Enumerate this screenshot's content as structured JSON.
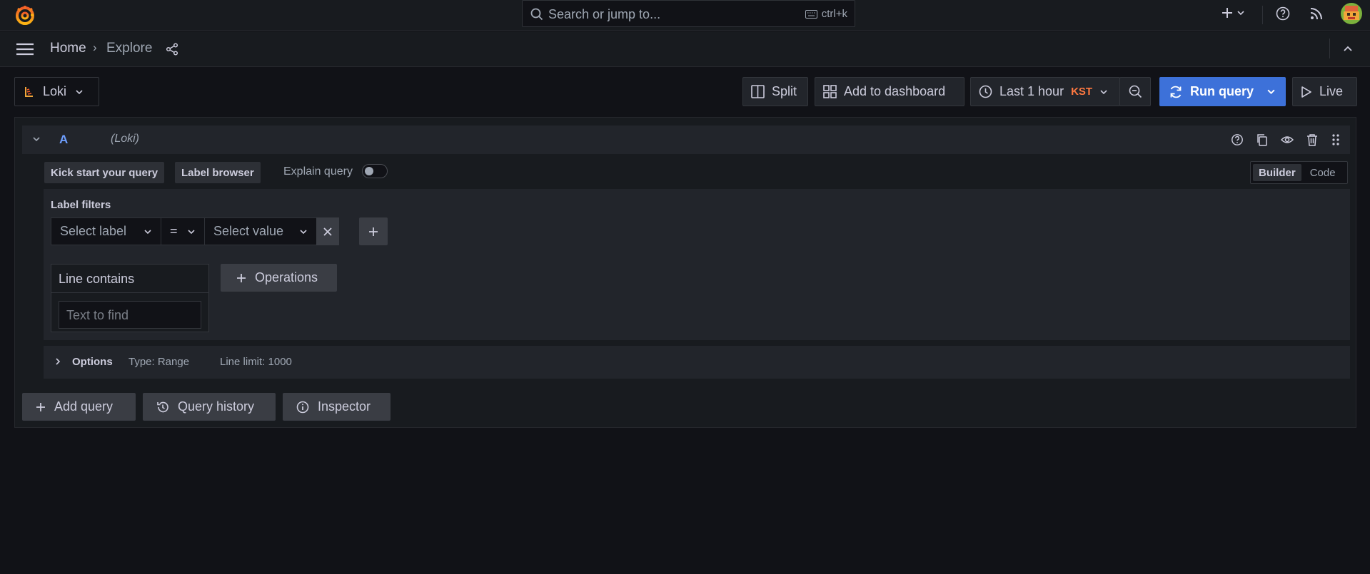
{
  "topbar": {
    "search_placeholder": "Search or jump to...",
    "search_shortcut": "ctrl+k"
  },
  "breadcrumb": {
    "home": "Home",
    "separator": "›",
    "current": "Explore"
  },
  "toolbar": {
    "datasource": "Loki",
    "split_label": "Split",
    "add_to_dashboard_label": "Add to dashboard",
    "time_range_label": "Last 1 hour",
    "timezone": "KST",
    "run_query_label": "Run query",
    "live_label": "Live"
  },
  "query": {
    "ref_id": "A",
    "datasource_label": "(Loki)",
    "kick_start_label": "Kick start your query",
    "label_browser_label": "Label browser",
    "explain_query_label": "Explain query",
    "explain_query_enabled": false,
    "mode_options": [
      "Builder",
      "Code"
    ],
    "mode_selected": "Builder",
    "label_filters_title": "Label filters",
    "select_label_placeholder": "Select label",
    "operator": "=",
    "select_value_placeholder": "Select value",
    "line_contains_title": "Line contains",
    "text_to_find_placeholder": "Text to find",
    "operations_label": "Operations",
    "options_label": "Options",
    "options_type": "Type: Range",
    "options_line_limit": "Line limit: 1000"
  },
  "actions": {
    "add_query_label": "Add query",
    "query_history_label": "Query history",
    "inspector_label": "Inspector"
  },
  "colors": {
    "background": "#111217",
    "panel": "#181b1f",
    "primary": "#3d71d9",
    "timezone": "#ff7941",
    "ref_id": "#6e9fff"
  }
}
